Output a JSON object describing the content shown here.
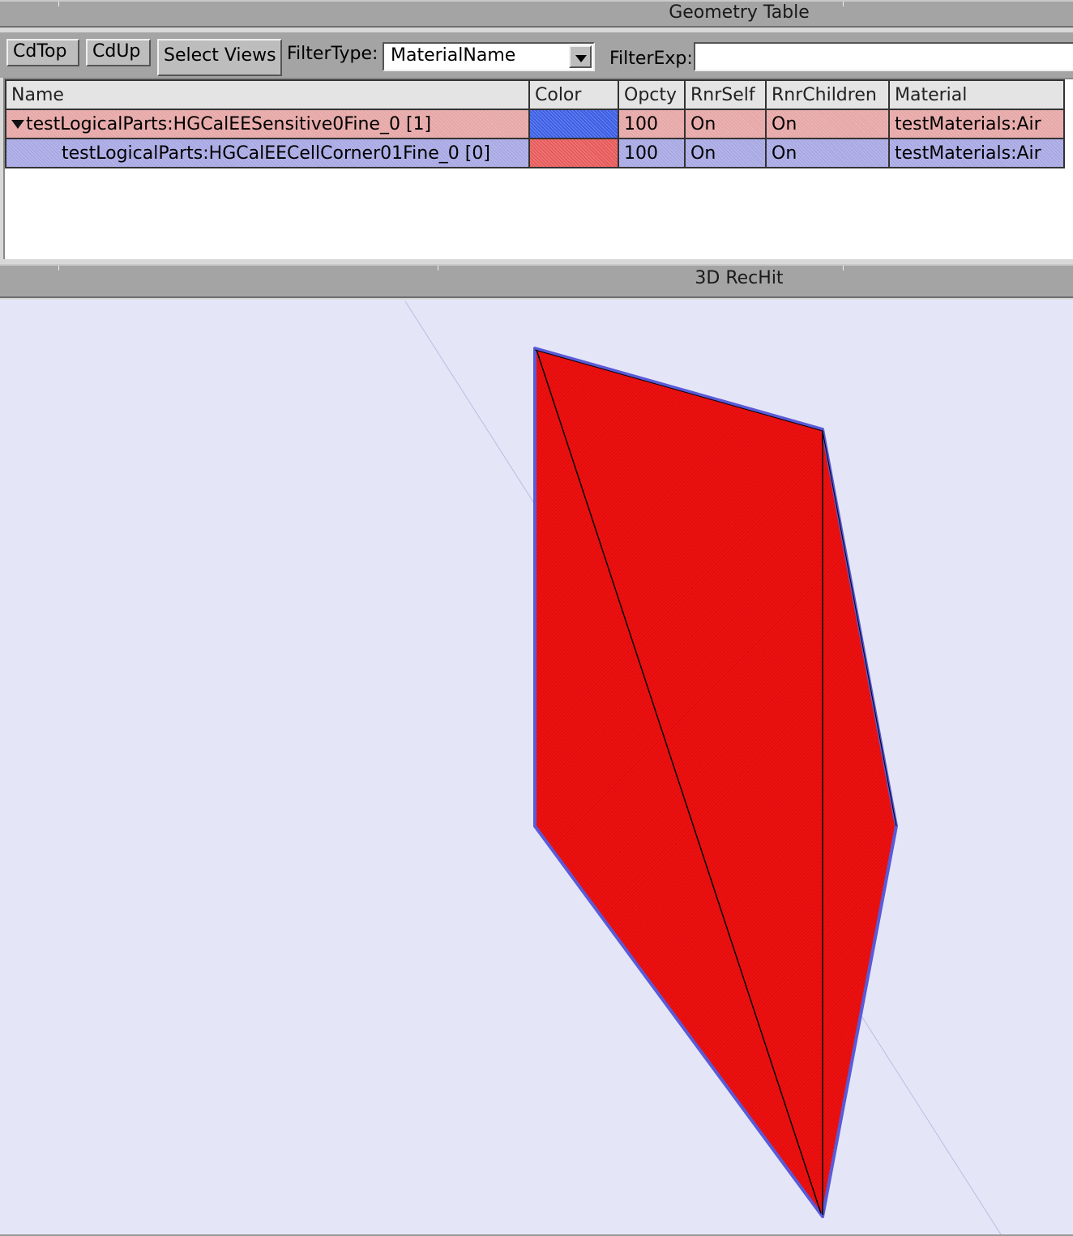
{
  "geometry_table": {
    "title": "Geometry Table",
    "toolbar": {
      "cdtop_label": "CdTop",
      "cdup_label": "CdUp",
      "select_views_label": "Select Views",
      "filter_type_label": "FilterType:",
      "filter_type_value": "MaterialName",
      "filter_exp_label": "FilterExp:",
      "filter_exp_value": ""
    },
    "columns": [
      "Name",
      "Color",
      "Opcty",
      "RnrSelf",
      "RnrChildren",
      "Material"
    ],
    "rows": [
      {
        "name": "testLogicalParts:HGCalEESensitive0Fine_0 [1]",
        "color": "#3b5ee6",
        "opacity": "100",
        "rnr_self": "On",
        "rnr_children": "On",
        "material": "testMaterials:Air",
        "expanded": true
      },
      {
        "name": "testLogicalParts:HGCalEECellCorner01Fine_0 [0]",
        "color": "#e85a5a",
        "opacity": "100",
        "rnr_self": "On",
        "rnr_children": "On",
        "material": "testMaterials:Air",
        "expanded": false
      }
    ]
  },
  "rechit_view": {
    "title": "3D RecHit",
    "background": "#e4e6f8",
    "shape_fill": "#ee1111",
    "shape_outline": "#5a5ad8"
  }
}
